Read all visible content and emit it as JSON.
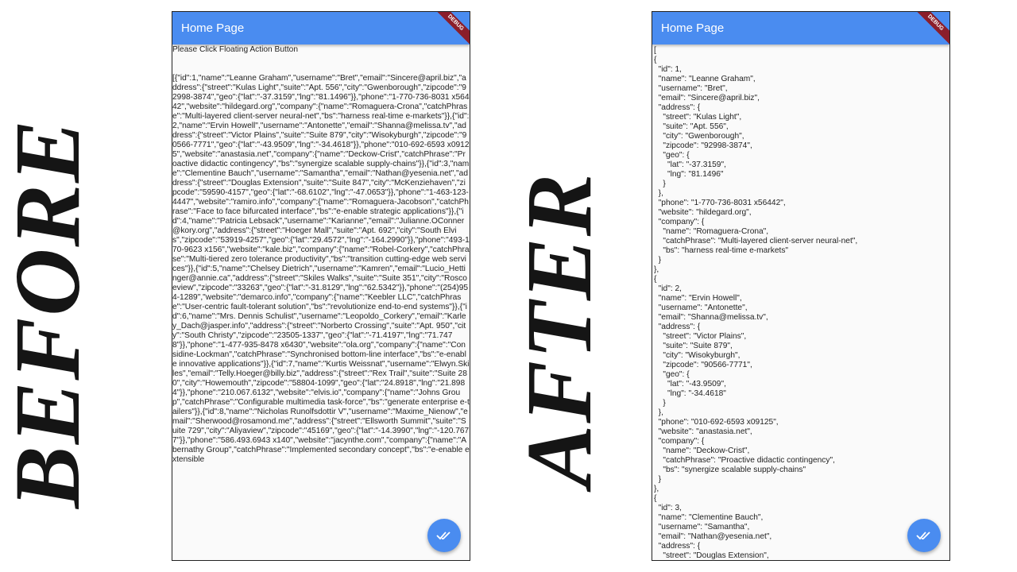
{
  "labels": {
    "before": "BEFORE",
    "after": "AFTER"
  },
  "app": {
    "title": "Home Page",
    "debug_banner": "DEBUG"
  },
  "before": {
    "prompt": "Please Click Floating Action Button",
    "raw_json": "[{\"id\":1,\"name\":\"Leanne Graham\",\"username\":\"Bret\",\"email\":\"Sincere@april.biz\",\"address\":{\"street\":\"Kulas Light\",\"suite\":\"Apt. 556\",\"city\":\"Gwenborough\",\"zipcode\":\"92998-3874\",\"geo\":{\"lat\":\"-37.3159\",\"lng\":\"81.1496\"}},\"phone\":\"1-770-736-8031 x56442\",\"website\":\"hildegard.org\",\"company\":{\"name\":\"Romaguera-Crona\",\"catchPhrase\":\"Multi-layered client-server neural-net\",\"bs\":\"harness real-time e-markets\"}},{\"id\":2,\"name\":\"Ervin Howell\",\"username\":\"Antonette\",\"email\":\"Shanna@melissa.tv\",\"address\":{\"street\":\"Victor Plains\",\"suite\":\"Suite 879\",\"city\":\"Wisokyburgh\",\"zipcode\":\"90566-7771\",\"geo\":{\"lat\":\"-43.9509\",\"lng\":\"-34.4618\"}},\"phone\":\"010-692-6593 x09125\",\"website\":\"anastasia.net\",\"company\":{\"name\":\"Deckow-Crist\",\"catchPhrase\":\"Proactive didactic contingency\",\"bs\":\"synergize scalable supply-chains\"}},{\"id\":3,\"name\":\"Clementine Bauch\",\"username\":\"Samantha\",\"email\":\"Nathan@yesenia.net\",\"address\":{\"street\":\"Douglas Extension\",\"suite\":\"Suite 847\",\"city\":\"McKenziehaven\",\"zipcode\":\"59590-4157\",\"geo\":{\"lat\":\"-68.6102\",\"lng\":\"-47.0653\"}},\"phone\":\"1-463-123-4447\",\"website\":\"ramiro.info\",\"company\":{\"name\":\"Romaguera-Jacobson\",\"catchPhrase\":\"Face to face bifurcated interface\",\"bs\":\"e-enable strategic applications\"}},{\"id\":4,\"name\":\"Patricia Lebsack\",\"username\":\"Karianne\",\"email\":\"Julianne.OConner@kory.org\",\"address\":{\"street\":\"Hoeger Mall\",\"suite\":\"Apt. 692\",\"city\":\"South Elvis\",\"zipcode\":\"53919-4257\",\"geo\":{\"lat\":\"29.4572\",\"lng\":\"-164.2990\"}},\"phone\":\"493-170-9623 x156\",\"website\":\"kale.biz\",\"company\":{\"name\":\"Robel-Corkery\",\"catchPhrase\":\"Multi-tiered zero tolerance productivity\",\"bs\":\"transition cutting-edge web services\"}},{\"id\":5,\"name\":\"Chelsey Dietrich\",\"username\":\"Kamren\",\"email\":\"Lucio_Hettinger@annie.ca\",\"address\":{\"street\":\"Skiles Walks\",\"suite\":\"Suite 351\",\"city\":\"Roscoeview\",\"zipcode\":\"33263\",\"geo\":{\"lat\":\"-31.8129\",\"lng\":\"62.5342\"}},\"phone\":\"(254)954-1289\",\"website\":\"demarco.info\",\"company\":{\"name\":\"Keebler LLC\",\"catchPhrase\":\"User-centric fault-tolerant solution\",\"bs\":\"revolutionize end-to-end systems\"}},{\"id\":6,\"name\":\"Mrs. Dennis Schulist\",\"username\":\"Leopoldo_Corkery\",\"email\":\"Karley_Dach@jasper.info\",\"address\":{\"street\":\"Norberto Crossing\",\"suite\":\"Apt. 950\",\"city\":\"South Christy\",\"zipcode\":\"23505-1337\",\"geo\":{\"lat\":\"-71.4197\",\"lng\":\"71.7478\"}},\"phone\":\"1-477-935-8478 x6430\",\"website\":\"ola.org\",\"company\":{\"name\":\"Considine-Lockman\",\"catchPhrase\":\"Synchronised bottom-line interface\",\"bs\":\"e-enable innovative applications\"}},{\"id\":7,\"name\":\"Kurtis Weissnat\",\"username\":\"Elwyn.Skiles\",\"email\":\"Telly.Hoeger@billy.biz\",\"address\":{\"street\":\"Rex Trail\",\"suite\":\"Suite 280\",\"city\":\"Howemouth\",\"zipcode\":\"58804-1099\",\"geo\":{\"lat\":\"24.8918\",\"lng\":\"21.8984\"}},\"phone\":\"210.067.6132\",\"website\":\"elvis.io\",\"company\":{\"name\":\"Johns Group\",\"catchPhrase\":\"Configurable multimedia task-force\",\"bs\":\"generate enterprise e-tailers\"}},{\"id\":8,\"name\":\"Nicholas Runolfsdottir V\",\"username\":\"Maxime_Nienow\",\"email\":\"Sherwood@rosamond.me\",\"address\":{\"street\":\"Ellsworth Summit\",\"suite\":\"Suite 729\",\"city\":\"Aliyaview\",\"zipcode\":\"45169\",\"geo\":{\"lat\":\"-14.3990\",\"lng\":\"-120.7677\"}},\"phone\":\"586.493.6943 x140\",\"website\":\"jacynthe.com\",\"company\":{\"name\":\"Abernathy Group\",\"catchPhrase\":\"Implemented secondary concept\",\"bs\":\"e-enable extensible"
  },
  "after": {
    "pretty_json": "[\n{\n  \"id\": 1,\n  \"name\": \"Leanne Graham\",\n  \"username\": \"Bret\",\n  \"email\": \"Sincere@april.biz\",\n  \"address\": {\n    \"street\": \"Kulas Light\",\n    \"suite\": \"Apt. 556\",\n    \"city\": \"Gwenborough\",\n    \"zipcode\": \"92998-3874\",\n    \"geo\": {\n      \"lat\": \"-37.3159\",\n      \"lng\": \"81.1496\"\n    }\n  },\n  \"phone\": \"1-770-736-8031 x56442\",\n  \"website\": \"hildegard.org\",\n  \"company\": {\n    \"name\": \"Romaguera-Crona\",\n    \"catchPhrase\": \"Multi-layered client-server neural-net\",\n    \"bs\": \"harness real-time e-markets\"\n  }\n},\n{\n  \"id\": 2,\n  \"name\": \"Ervin Howell\",\n  \"username\": \"Antonette\",\n  \"email\": \"Shanna@melissa.tv\",\n  \"address\": {\n    \"street\": \"Victor Plains\",\n    \"suite\": \"Suite 879\",\n    \"city\": \"Wisokyburgh\",\n    \"zipcode\": \"90566-7771\",\n    \"geo\": {\n      \"lat\": \"-43.9509\",\n      \"lng\": \"-34.4618\"\n    }\n  },\n  \"phone\": \"010-692-6593 x09125\",\n  \"website\": \"anastasia.net\",\n  \"company\": {\n    \"name\": \"Deckow-Crist\",\n    \"catchPhrase\": \"Proactive didactic contingency\",\n    \"bs\": \"synergize scalable supply-chains\"\n  }\n},\n{\n  \"id\": 3,\n  \"name\": \"Clementine Bauch\",\n  \"username\": \"Samantha\",\n  \"email\": \"Nathan@yesenia.net\",\n  \"address\": {\n    \"street\": \"Douglas Extension\","
  },
  "fab": {
    "icon": "double-check-icon",
    "color": "#4a8cf0"
  },
  "colors": {
    "appbar": "#4a8cf0",
    "debug": "#8b1e2b"
  }
}
